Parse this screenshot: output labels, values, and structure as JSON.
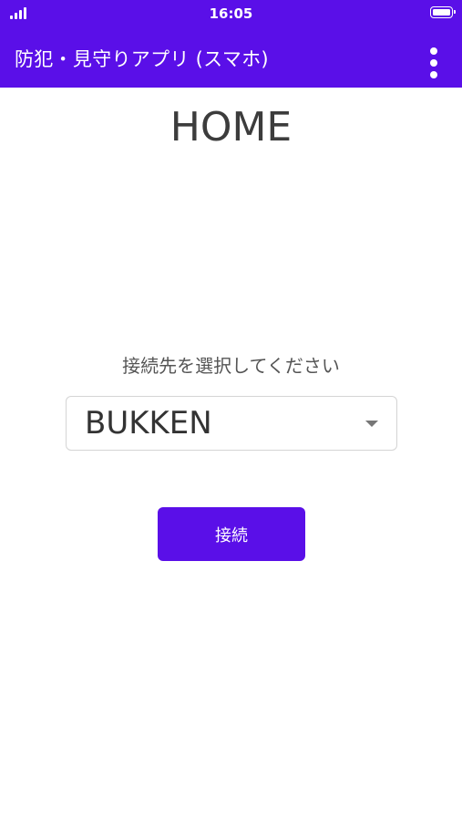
{
  "status_bar": {
    "time": "16:05",
    "signal_icon": "cellular-signal-icon",
    "battery_icon": "battery-full-icon"
  },
  "app_bar": {
    "title": "防犯・見守りアプリ (スマホ)",
    "menu_icon": "more-vert-icon"
  },
  "main": {
    "title": "HOME",
    "prompt": "接続先を選択してください",
    "destination_select": {
      "selected": "BUKKEN",
      "caret_icon": "dropdown-caret-icon"
    },
    "connect_label": "接続"
  },
  "colors": {
    "primary": "#5a0fe8",
    "text_dark": "#3c3c3c",
    "text_muted": "#555555",
    "select_border": "#d4d4d4"
  }
}
